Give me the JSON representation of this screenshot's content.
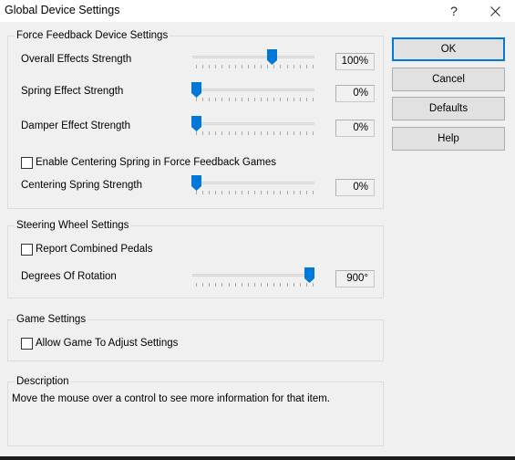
{
  "window": {
    "title": "Global Device Settings",
    "help_button": "?",
    "close_icon": "close-icon"
  },
  "force_feedback": {
    "group_label": "Force Feedback Device Settings",
    "overall": {
      "label": "Overall Effects Strength",
      "value_text": "100%",
      "slider_position": 0.65
    },
    "spring": {
      "label": "Spring Effect Strength",
      "value_text": "0%",
      "slider_position": 0.0
    },
    "damper": {
      "label": "Damper Effect Strength",
      "value_text": "0%",
      "slider_position": 0.0
    },
    "enable_centering": {
      "label": "Enable Centering Spring in Force Feedback Games",
      "checked": false
    },
    "centering": {
      "label": "Centering Spring Strength",
      "value_text": "0%",
      "slider_position": 0.0
    }
  },
  "steering": {
    "group_label": "Steering Wheel Settings",
    "combined_pedals": {
      "label": "Report Combined Pedals",
      "checked": false
    },
    "rotation": {
      "label": "Degrees Of Rotation",
      "value_text": "900°",
      "slider_position": 0.97
    }
  },
  "game": {
    "group_label": "Game Settings",
    "allow_adjust": {
      "label": "Allow Game To Adjust Settings",
      "checked": false
    }
  },
  "description": {
    "group_label": "Description",
    "text": "Move the mouse over a control to see more information for that item."
  },
  "buttons": {
    "ok": "OK",
    "cancel": "Cancel",
    "defaults": "Defaults",
    "help": "Help"
  },
  "colors": {
    "accent": "#0078d7",
    "background": "#f0f0f0",
    "titlebar": "#ffffff"
  }
}
